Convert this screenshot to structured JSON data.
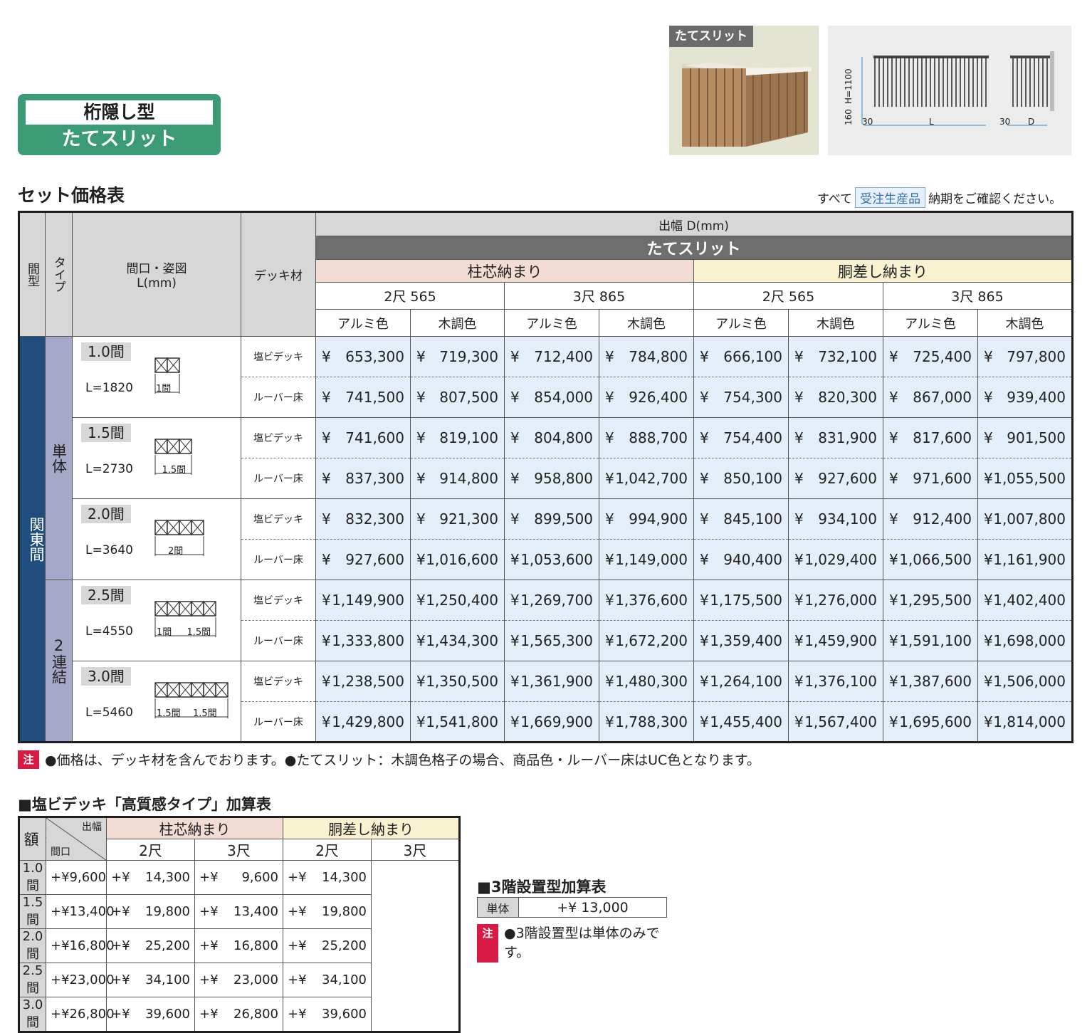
{
  "badge": {
    "line1": "桁隠し型",
    "line2": "たてスリット"
  },
  "photo": {
    "tag": "たてスリット"
  },
  "dims": {
    "h1100": "H=1100",
    "h160": "160",
    "w30a": "30",
    "L": "L",
    "w30b": "30",
    "D": "D"
  },
  "section_title": "セット価格表",
  "notice": {
    "pre": "すべて",
    "chip": "受注生産品",
    "post": "納期をご確認ください。"
  },
  "table": {
    "h_kengata": "間型",
    "h_type": "タイプ",
    "h_maguchi": "間口・姿図",
    "h_maguchi2": "L(mm)",
    "h_deck": "デッキ材",
    "h_debaba": "出幅 D(mm)",
    "h_band": "たてスリット",
    "h_group1": "柱芯納まり",
    "h_group2": "胴差し納まり",
    "sizes": [
      "2尺 565",
      "3尺 865",
      "2尺 565",
      "3尺 865"
    ],
    "colors": [
      "アルミ色",
      "木調色",
      "アルミ色",
      "木調色",
      "アルミ色",
      "木調色",
      "アルミ色",
      "木調色"
    ],
    "kanto": "関東間",
    "type_single": "単体",
    "type_double": "2連結",
    "deck_types": [
      "塩ビデッキ",
      "ルーバー床"
    ],
    "rows": [
      {
        "label": "1.0間",
        "L": "L=1820",
        "dim": [
          "1間"
        ],
        "prices": [
          [
            "653,300",
            "719,300",
            "712,400",
            "784,800",
            "666,100",
            "732,100",
            "725,400",
            "797,800"
          ],
          [
            "741,500",
            "807,500",
            "854,000",
            "926,400",
            "754,300",
            "820,300",
            "867,000",
            "939,400"
          ]
        ]
      },
      {
        "label": "1.5間",
        "L": "L=2730",
        "dim": [
          "1.5間"
        ],
        "prices": [
          [
            "741,600",
            "819,100",
            "804,800",
            "888,700",
            "754,400",
            "831,900",
            "817,600",
            "901,500"
          ],
          [
            "837,300",
            "914,800",
            "958,800",
            "1,042,700",
            "850,100",
            "927,600",
            "971,600",
            "1,055,500"
          ]
        ]
      },
      {
        "label": "2.0間",
        "L": "L=3640",
        "dim": [
          "2間"
        ],
        "prices": [
          [
            "832,300",
            "921,300",
            "899,500",
            "994,900",
            "845,100",
            "934,100",
            "912,400",
            "1,007,800"
          ],
          [
            "927,600",
            "1,016,600",
            "1,053,600",
            "1,149,000",
            "940,400",
            "1,029,400",
            "1,066,500",
            "1,161,900"
          ]
        ]
      },
      {
        "label": "2.5間",
        "L": "L=4550",
        "dim": [
          "1間",
          "1.5間"
        ],
        "prices": [
          [
            "1,149,900",
            "1,250,400",
            "1,269,700",
            "1,376,600",
            "1,175,500",
            "1,276,000",
            "1,295,500",
            "1,402,400"
          ],
          [
            "1,333,800",
            "1,434,300",
            "1,565,300",
            "1,672,200",
            "1,359,400",
            "1,459,900",
            "1,591,100",
            "1,698,000"
          ]
        ]
      },
      {
        "label": "3.0間",
        "L": "L=5460",
        "dim": [
          "1.5間",
          "1.5間"
        ],
        "prices": [
          [
            "1,238,500",
            "1,350,500",
            "1,361,900",
            "1,480,300",
            "1,264,100",
            "1,376,100",
            "1,387,600",
            "1,506,000"
          ],
          [
            "1,429,800",
            "1,541,800",
            "1,669,900",
            "1,788,300",
            "1,455,400",
            "1,567,400",
            "1,695,600",
            "1,814,000"
          ]
        ]
      }
    ],
    "yen": "¥"
  },
  "note1": {
    "tag": "注",
    "text": "●価格は、デッキ材を含んでおります。●たてスリット：木調色格子の場合、商品色・ルーバー床はUC色となります。"
  },
  "sub": {
    "title": "■塩ビデッキ「高質感タイプ」加算表",
    "h_debaba": "出幅",
    "h_maguchi": "間口",
    "h_group1": "柱芯納まり",
    "h_group2": "胴差し納まり",
    "sizes": [
      "2尺",
      "3尺",
      "2尺",
      "3尺"
    ],
    "side": "加算額",
    "prefix": "+¥",
    "rows": [
      {
        "label": "1.0間",
        "values": [
          "9,600",
          "14,300",
          "9,600",
          "14,300"
        ]
      },
      {
        "label": "1.5間",
        "values": [
          "13,400",
          "19,800",
          "13,400",
          "19,800"
        ]
      },
      {
        "label": "2.0間",
        "values": [
          "16,800",
          "25,200",
          "16,800",
          "25,200"
        ]
      },
      {
        "label": "2.5間",
        "values": [
          "23,000",
          "34,100",
          "23,000",
          "34,100"
        ]
      },
      {
        "label": "3.0間",
        "values": [
          "26,800",
          "39,600",
          "26,800",
          "39,600"
        ]
      }
    ]
  },
  "third": {
    "title": "■3階設置型加算表",
    "label": "単体",
    "value": "+¥ 13,000",
    "note_tag": "注",
    "note": "●3階設置型は単体のみです。"
  }
}
